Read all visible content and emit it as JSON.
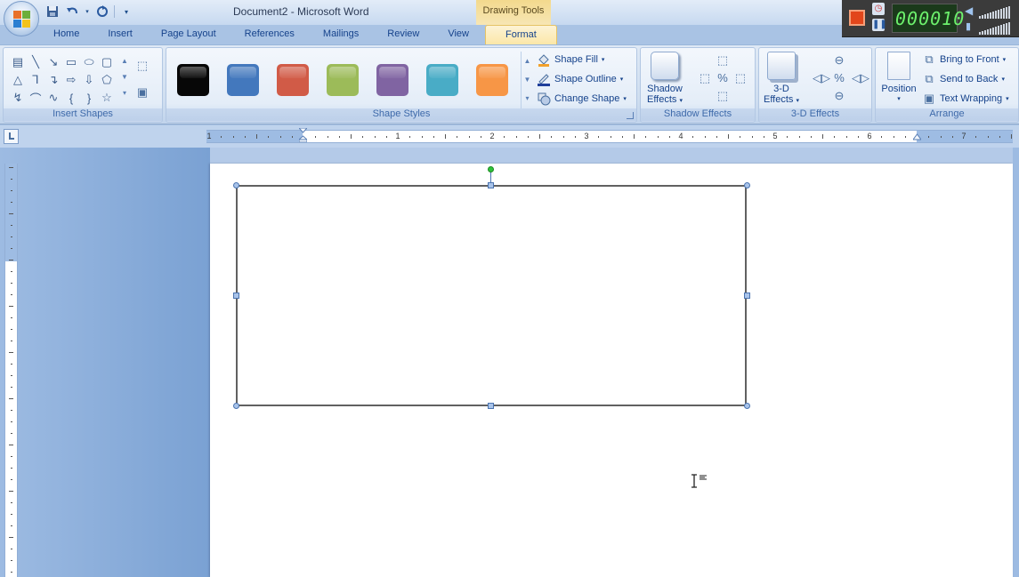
{
  "window": {
    "title": "Document2 - Microsoft Word",
    "contextual_header": "Drawing Tools"
  },
  "recorder": {
    "counter": "000010"
  },
  "tabs": [
    {
      "label": "Home",
      "active": false
    },
    {
      "label": "Insert",
      "active": false
    },
    {
      "label": "Page Layout",
      "active": false
    },
    {
      "label": "References",
      "active": false
    },
    {
      "label": "Mailings",
      "active": false
    },
    {
      "label": "Review",
      "active": false
    },
    {
      "label": "View",
      "active": false
    },
    {
      "label": "Format",
      "active": true
    }
  ],
  "ribbon": {
    "insert_shapes": {
      "label": "Insert Shapes"
    },
    "shape_styles": {
      "label": "Shape Styles",
      "swatches": [
        {
          "color": "#070707"
        },
        {
          "color": "#4378bd"
        },
        {
          "color": "#d15b47"
        },
        {
          "color": "#9cbb59"
        },
        {
          "color": "#8064a2"
        },
        {
          "color": "#49acc6"
        },
        {
          "color": "#f79646"
        }
      ],
      "shape_fill": "Shape Fill",
      "shape_outline": "Shape Outline",
      "change_shape": "Change Shape"
    },
    "shadow_effects": {
      "label": "Shadow Effects",
      "button_line1": "Shadow",
      "button_line2": "Effects"
    },
    "three_d_effects": {
      "label": "3-D Effects",
      "button_line1": "3-D",
      "button_line2": "Effects"
    },
    "arrange": {
      "label": "Arrange",
      "position": "Position",
      "bring_to_front": "Bring to Front",
      "send_to_back": "Send to Back",
      "text_wrapping": "Text Wrapping"
    }
  },
  "ruler": {
    "numbers": [
      "1",
      "1",
      "2",
      "3",
      "4",
      "5",
      "6",
      "7"
    ]
  },
  "colors": {
    "selection_handle": "#a9c4ea",
    "rotation_handle": "#2fc23a",
    "shape_outline": "#616161"
  }
}
